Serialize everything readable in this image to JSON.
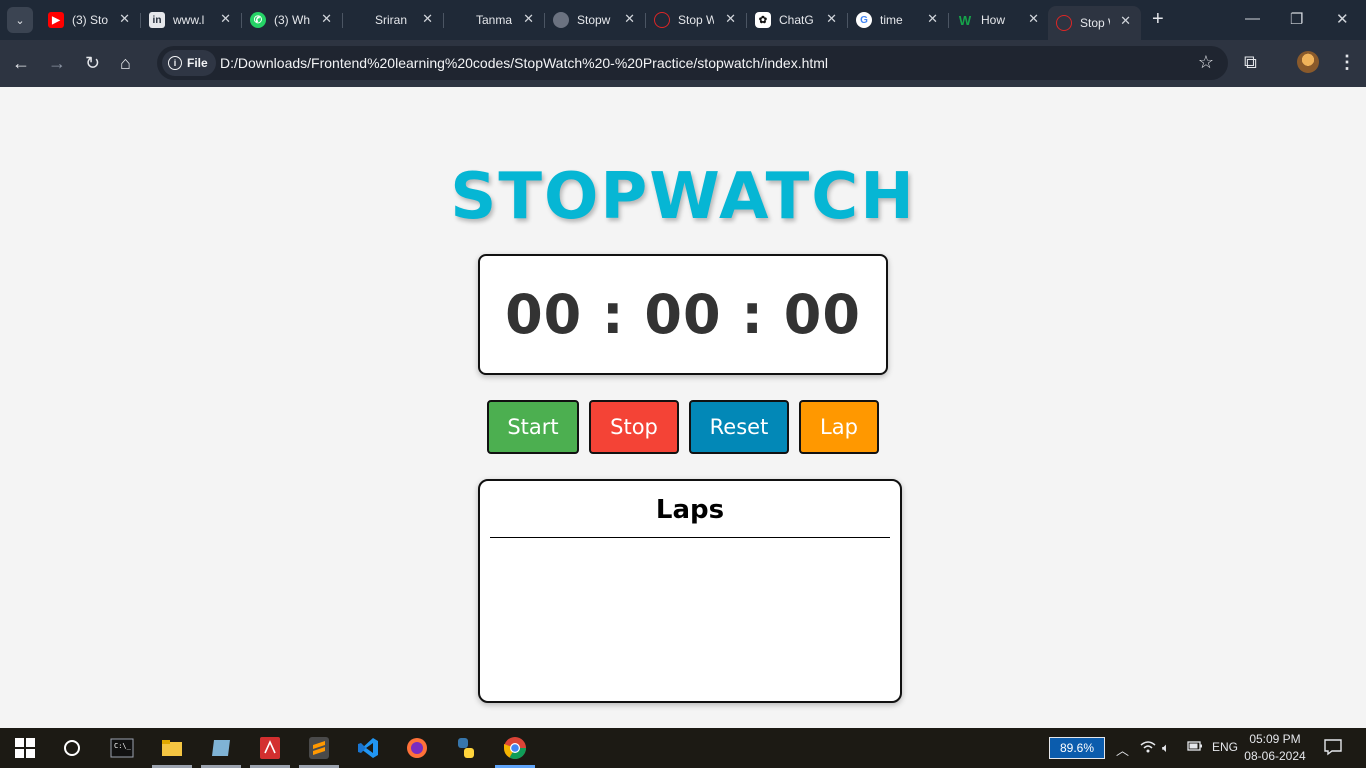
{
  "browser": {
    "tabs": [
      {
        "label": "(3) Sto",
        "icon": "youtube-icon",
        "color": "#ff0000"
      },
      {
        "label": "www.l",
        "icon": "linkedin-icon",
        "color": "#0a66c2"
      },
      {
        "label": "(3) Wh",
        "icon": "whatsapp-icon",
        "color": "#25d366"
      },
      {
        "label": "Sriran",
        "icon": "page-icon",
        "color": "#374151"
      },
      {
        "label": "Tanma",
        "icon": "page-icon",
        "color": "#374151"
      },
      {
        "label": "Stopw",
        "icon": "globe-icon",
        "color": "#9ca3af"
      },
      {
        "label": "Stop W",
        "icon": "stopwatch-icon",
        "color": "#dc2626"
      },
      {
        "label": "ChatG",
        "icon": "chatgpt-icon",
        "color": "#ffffff"
      },
      {
        "label": "time",
        "icon": "google-icon",
        "color": "#4285f4"
      },
      {
        "label": "How",
        "icon": "w-icon",
        "color": "#16a34a"
      },
      {
        "label": "Stop W",
        "icon": "stopwatch-icon",
        "color": "#dc2626"
      }
    ],
    "omnibox": {
      "scheme_label": "File",
      "url": "D:/Downloads/Frontend%20learning%20codes/StopWatch%20-%20Practice/stopwatch/index.html"
    }
  },
  "page": {
    "title": "STOPWATCH",
    "time_display": "00 : 00 : 00",
    "buttons": {
      "start": "Start",
      "stop": "Stop",
      "reset": "Reset",
      "lap": "Lap"
    },
    "laps": {
      "heading": "Laps",
      "items": []
    },
    "colors": {
      "title": "#06b6d4",
      "start": "#4caf50",
      "stop": "#f44336",
      "reset": "#0288b7",
      "lap": "#ff9800"
    }
  },
  "taskbar": {
    "battery": "89.6%",
    "language": "ENG",
    "time": "05:09 PM",
    "date": "08-06-2024"
  }
}
